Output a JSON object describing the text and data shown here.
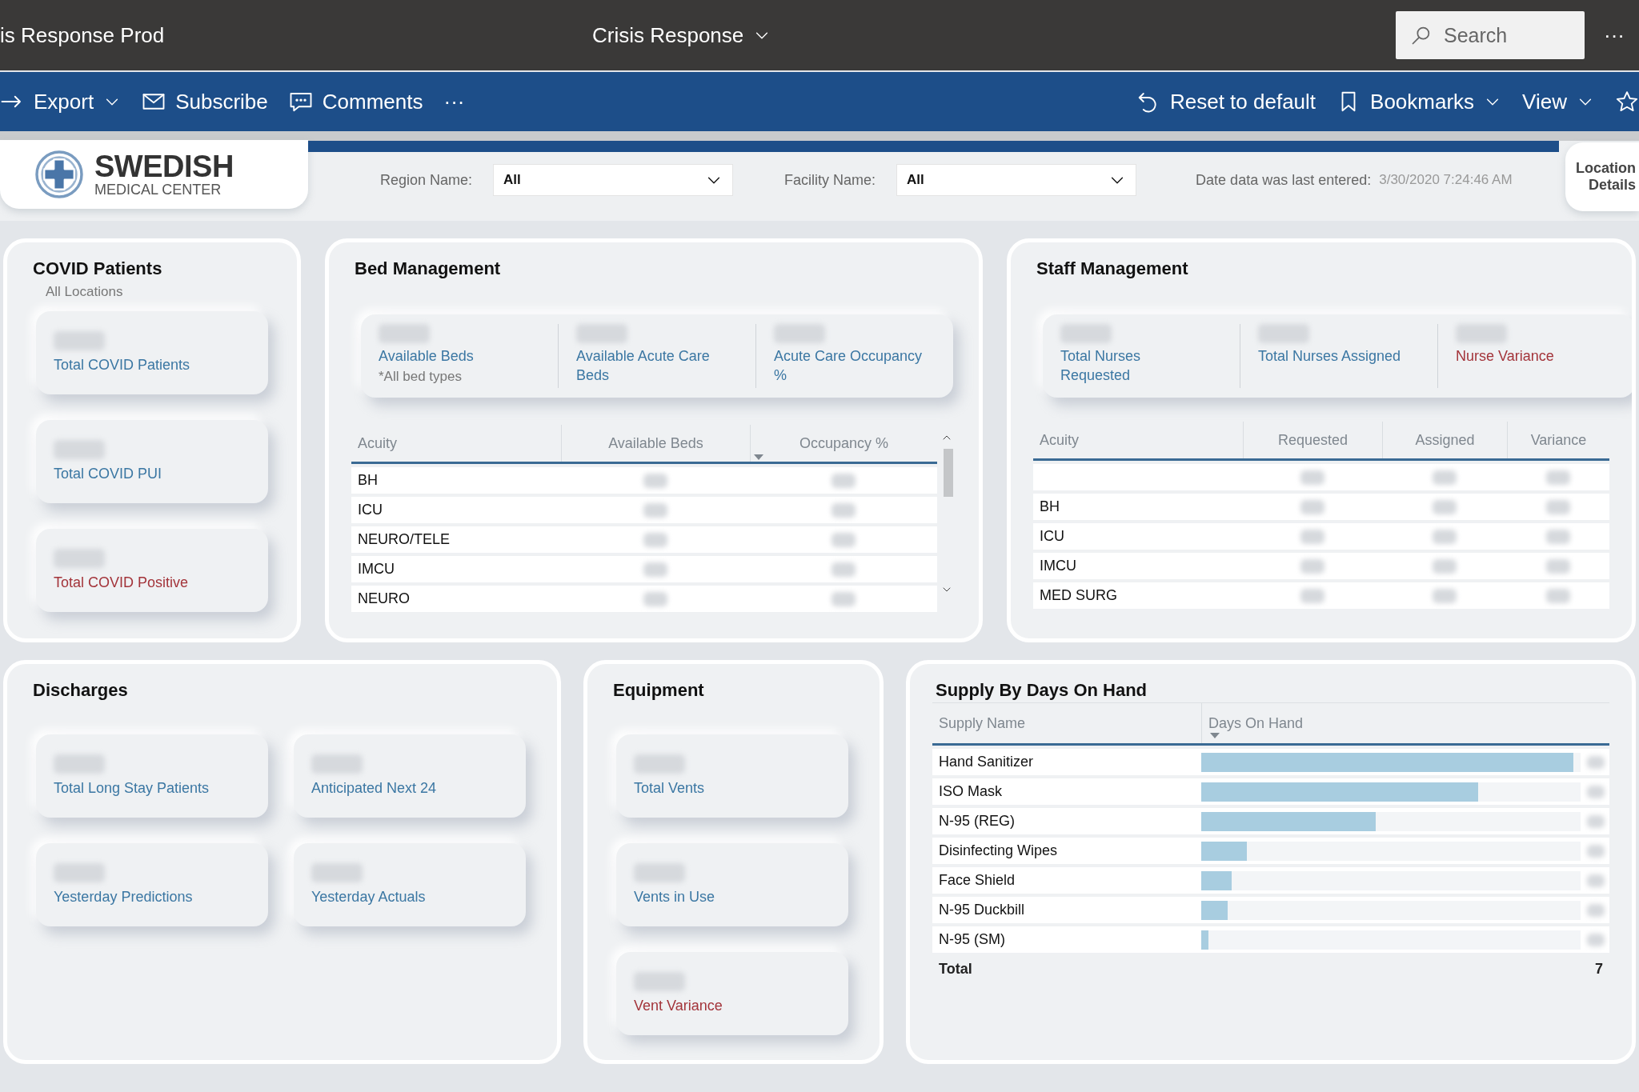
{
  "app_bar": {
    "report_title": "is Response Prod",
    "workspace": "Crisis Response",
    "search": {
      "placeholder": "Search"
    },
    "more": "···"
  },
  "toolbar": {
    "left": [
      {
        "label": "Export",
        "dropdown": true
      },
      {
        "label": "Subscribe",
        "dropdown": false
      },
      {
        "label": "Comments",
        "dropdown": false
      },
      {
        "label": "···",
        "dropdown": false
      }
    ],
    "right": [
      {
        "label": "Reset to default",
        "dropdown": false
      },
      {
        "label": "Bookmarks",
        "dropdown": true
      },
      {
        "label": "View",
        "dropdown": true
      }
    ]
  },
  "header": {
    "logo": {
      "name": "SWEDISH",
      "subtitle": "MEDICAL CENTER"
    },
    "filters": [
      {
        "label": "Region Name:",
        "value": "All"
      },
      {
        "label": "Facility Name:",
        "value": "All"
      }
    ],
    "last_entered": {
      "label": "Date data was last entered:",
      "value": "3/30/2020 7:24:46 AM"
    },
    "location_button": "Location Details"
  },
  "covid_patients": {
    "title": "COVID Patients",
    "subtitle": "All Locations",
    "cards": [
      {
        "label": "Total COVID Patients",
        "alert": false
      },
      {
        "label": "Total COVID PUI",
        "alert": false
      },
      {
        "label": "Total COVID Positive",
        "alert": true
      }
    ]
  },
  "bed_management": {
    "title": "Bed Management",
    "kpis": [
      {
        "label": "Available Beds",
        "note": "*All bed types",
        "alert": false
      },
      {
        "label": "Available Acute Care Beds",
        "alert": false
      },
      {
        "label": "Acute Care Occupancy %",
        "alert": false
      }
    ],
    "table": {
      "columns": [
        {
          "label": "Acuity",
          "sorted": false
        },
        {
          "label": "Available Beds",
          "sorted": false
        },
        {
          "label": "Occupancy %",
          "sorted": true
        }
      ],
      "rows": [
        {
          "acuity": "BH"
        },
        {
          "acuity": "ICU"
        },
        {
          "acuity": "NEURO/TELE"
        },
        {
          "acuity": "IMCU"
        },
        {
          "acuity": "NEURO"
        }
      ]
    }
  },
  "staff_management": {
    "title": "Staff Management",
    "kpis": [
      {
        "label": "Total Nurses Requested",
        "alert": false
      },
      {
        "label": "Total Nurses Assigned",
        "alert": false
      },
      {
        "label": "Nurse Variance",
        "alert": true
      }
    ],
    "table": {
      "columns": [
        {
          "label": "Acuity",
          "sorted": false
        },
        {
          "label": "Requested",
          "sorted": false
        },
        {
          "label": "Assigned",
          "sorted": false
        },
        {
          "label": "Variance",
          "sorted": false
        }
      ],
      "rows": [
        {},
        {
          "acuity": "BH"
        },
        {
          "acuity": "ICU"
        },
        {
          "acuity": "IMCU"
        },
        {
          "acuity": "MED SURG"
        }
      ]
    }
  },
  "discharges": {
    "title": "Discharges",
    "cards": [
      {
        "label": "Total Long Stay Patients",
        "alert": false
      },
      {
        "label": "Anticipated Next 24",
        "alert": false
      },
      {
        "label": "Yesterday Predictions",
        "alert": false
      },
      {
        "label": "Yesterday Actuals",
        "alert": false
      }
    ]
  },
  "equipment": {
    "title": "Equipment",
    "cards": [
      {
        "label": "Total Vents",
        "alert": false
      },
      {
        "label": "Vents in Use",
        "alert": false
      },
      {
        "label": "Vent Variance",
        "alert": true
      }
    ]
  },
  "supply": {
    "title": "Supply By Days On Hand",
    "columns": [
      {
        "label": "Supply Name",
        "sorted": false
      },
      {
        "label": "Days On Hand",
        "sorted": true
      }
    ],
    "rows": [
      {
        "name": "Hand Sanitizer",
        "level": 0.98
      },
      {
        "name": "ISO Mask",
        "level": 0.73
      },
      {
        "name": "N-95 (REG)",
        "level": 0.46
      },
      {
        "name": "Disinfecting Wipes",
        "level": 0.12
      },
      {
        "name": "Face Shield",
        "level": 0.08
      },
      {
        "name": "N-95 Duckbill",
        "level": 0.07
      },
      {
        "name": "N-95 (SM)",
        "level": 0.02
      }
    ],
    "total": {
      "label": "Total",
      "value": "7"
    }
  }
}
